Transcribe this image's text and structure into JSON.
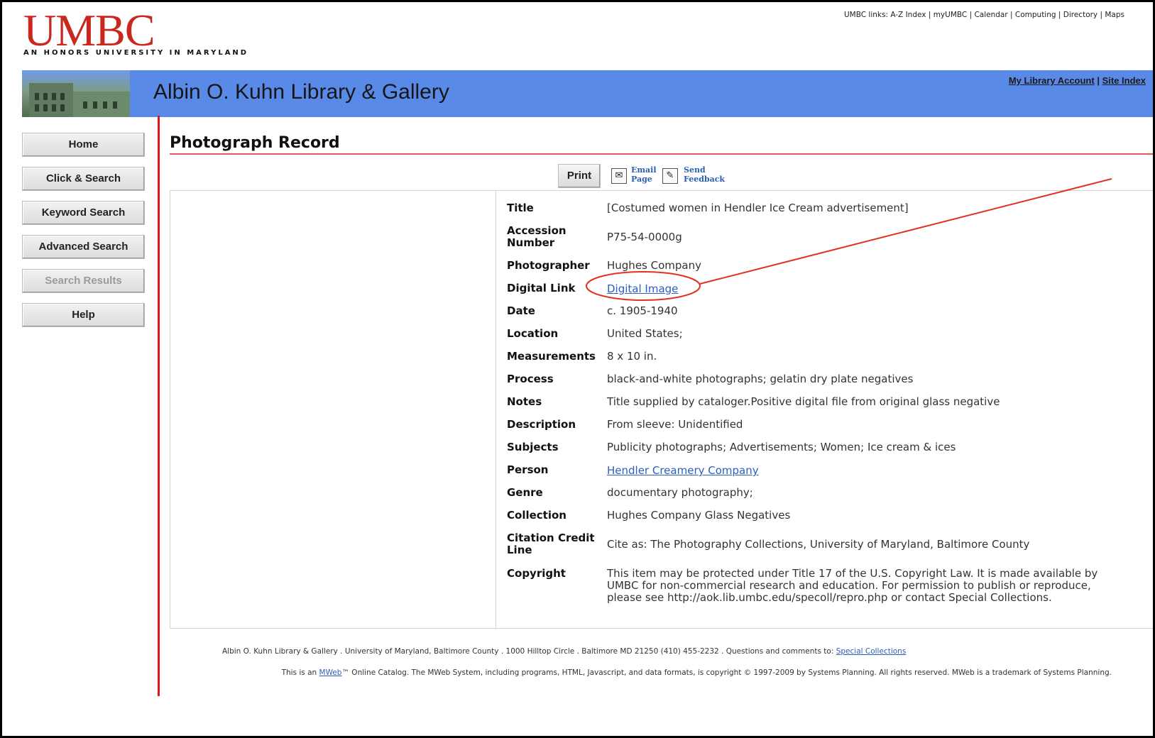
{
  "header": {
    "logo": "UMBC",
    "tagline": "AN HONORS UNIVERSITY IN MARYLAND",
    "top_links": "UMBC links: A-Z Index | myUMBC | Calendar | Computing | Directory | Maps"
  },
  "banner": {
    "title": "Albin O. Kuhn Library & Gallery",
    "my_account": "My Library Account",
    "separator": " | ",
    "site_index": "Site Index"
  },
  "sidebar": {
    "items": [
      {
        "label": "Home"
      },
      {
        "label": "Click & Search"
      },
      {
        "label": "Keyword Search"
      },
      {
        "label": "Advanced Search"
      },
      {
        "label": "Search Results"
      },
      {
        "label": "Help"
      }
    ]
  },
  "page": {
    "title": "Photograph Record"
  },
  "toolbar": {
    "print": "Print",
    "email_line1": "Email",
    "email_line2": "Page",
    "feedback_line1": "Send",
    "feedback_line2": "Feedback"
  },
  "record": {
    "rows": [
      {
        "label": "Title",
        "value": "[Costumed women in Hendler Ice Cream advertisement]"
      },
      {
        "label": "Accession Number",
        "value": "P75-54-0000g"
      },
      {
        "label": "Photographer",
        "value": "Hughes Company"
      },
      {
        "label": "Digital Link",
        "value": "Digital Image"
      },
      {
        "label": "Date",
        "value": "c. 1905-1940"
      },
      {
        "label": "Location",
        "value": "United States;"
      },
      {
        "label": "Measurements",
        "value": "8 x 10 in."
      },
      {
        "label": "Process",
        "value": "black-and-white photographs; gelatin dry plate negatives"
      },
      {
        "label": "Notes",
        "value": "Title supplied by cataloger.Positive digital file from original glass negative"
      },
      {
        "label": "Description",
        "value": "From sleeve: Unidentified"
      },
      {
        "label": "Subjects",
        "value": "Publicity photographs; Advertisements; Women; Ice cream & ices"
      },
      {
        "label": "Person",
        "value": "Hendler Creamery Company"
      },
      {
        "label": "Genre",
        "value": "documentary photography;"
      },
      {
        "label": "Collection",
        "value": "Hughes Company Glass Negatives"
      },
      {
        "label": "Citation Credit Line",
        "value": "Cite as: The Photography Collections, University of Maryland, Baltimore County"
      },
      {
        "label": "Copyright",
        "value": "This item may be protected under Title 17 of the U.S. Copyright Law. It is made available by UMBC for non-commercial research and education. For permission to publish or reproduce, please see http://aok.lib.umbc.edu/specoll/repro.php or contact Special Collections."
      }
    ]
  },
  "footer": {
    "address": "Albin O. Kuhn Library & Gallery . University of Maryland, Baltimore County . 1000 Hilltop Circle . Baltimore MD 21250 (410) 455-2232 . Questions and comments to: ",
    "contact_link": "Special Collections",
    "mweb_prefix": "This is an ",
    "mweb_link": "MWeb",
    "mweb_rest": "™ Online Catalog. The MWeb System, including programs, HTML, Javascript, and data formats, is copyright © 1997-2009 by Systems Planning. All rights reserved. MWeb is a trademark of Systems Planning."
  },
  "colors": {
    "accent_red": "#e0141e",
    "banner_blue": "#5a8ae8",
    "link_blue": "#2a5fc0",
    "annotation_red": "#e0321e"
  }
}
